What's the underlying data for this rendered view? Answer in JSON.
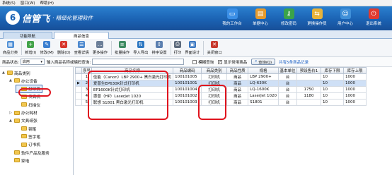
{
  "menu": {
    "items": [
      "系统(S)",
      "窗口(W)",
      "帮助(H)"
    ]
  },
  "brand": {
    "mark": "6",
    "name": "信管飞",
    "tagline": "· 精细化管理软件"
  },
  "topnav": [
    {
      "label": "我的工作台",
      "icon": "desktop-icon",
      "color": "#3b8fe6"
    },
    {
      "label": "单据中心",
      "icon": "document-icon",
      "color": "#e59a2c"
    },
    {
      "label": "修改密码",
      "icon": "user-key-icon",
      "color": "#3aa34a"
    },
    {
      "label": "更换操作员",
      "icon": "switch-user-icon",
      "color": "#e7b33a"
    },
    {
      "label": "用户中心",
      "icon": "user-center-icon",
      "color": "#3f8fd8"
    },
    {
      "label": "退出系统",
      "icon": "power-icon",
      "color": "#e03a2f"
    }
  ],
  "tabs": [
    "功能导航",
    "商品信息"
  ],
  "toolbar": [
    {
      "label": "商品分类",
      "icon": "category-icon",
      "color": "#4f8fd6",
      "glyph": "▦"
    },
    {
      "label": "新增(I)",
      "icon": "add-icon",
      "color": "#43a34a",
      "glyph": "+"
    },
    {
      "label": "修改(M)",
      "icon": "edit-icon",
      "color": "#3b7fd0",
      "glyph": "✎"
    },
    {
      "label": "删除(D)",
      "icon": "delete-icon",
      "color": "#d8352b",
      "glyph": "✕"
    },
    {
      "label": "查看详情",
      "icon": "details-icon",
      "color": "#4d89cf",
      "glyph": "☰"
    },
    {
      "label": "更多操作",
      "icon": "more-icon",
      "color": "#6c7f99",
      "glyph": "…"
    },
    {
      "label": "批量操作",
      "icon": "batch-icon",
      "color": "#3f8c64",
      "glyph": "≡"
    },
    {
      "label": "导入导出",
      "icon": "import-export-icon",
      "color": "#2e78c2",
      "glyph": "⇅"
    },
    {
      "label": "排序设置",
      "icon": "sort-icon",
      "color": "#5b7fb0",
      "glyph": "↕"
    },
    {
      "label": "打印",
      "icon": "print-icon",
      "color": "#5d6b7d",
      "glyph": "⎙"
    },
    {
      "label": "界面设计",
      "icon": "design-icon",
      "color": "#3d79c2",
      "glyph": "▣"
    },
    {
      "label": "关闭窗口",
      "icon": "close-window-icon",
      "color": "#c83a2e",
      "glyph": "✕"
    }
  ],
  "search": {
    "status_label": "商品状态:",
    "status_value": "启用",
    "keyword_label": "输入商品名称或编码查询:",
    "keyword_value": "",
    "fuzzy_label": "模糊查询",
    "fuzzy_checked": false,
    "show_common_label": "显示常用商品",
    "show_common_checked": true,
    "query_button": "查询(Q)",
    "result_text": "共有5条商品记录"
  },
  "tree": [
    {
      "label": "商品类别",
      "level": 0,
      "toggle": "▲"
    },
    {
      "label": "办公设备",
      "level": 1,
      "toggle": "▲"
    },
    {
      "label": "打印机",
      "level": 2,
      "toggle": "",
      "selected": true
    },
    {
      "label": "传真机",
      "level": 2,
      "toggle": ""
    },
    {
      "label": "扫描仪",
      "level": 2,
      "toggle": ""
    },
    {
      "label": "办公耗材",
      "level": 1,
      "toggle": "▷"
    },
    {
      "label": "文具纸张",
      "level": 1,
      "toggle": "▲"
    },
    {
      "label": "钢笔",
      "level": 2,
      "toggle": ""
    },
    {
      "label": "签字笔",
      "level": 2,
      "toggle": ""
    },
    {
      "label": "订书机",
      "level": 2,
      "toggle": ""
    },
    {
      "label": "软件产品及服务",
      "level": 1,
      "toggle": ""
    },
    {
      "label": "家电",
      "level": 1,
      "toggle": ""
    }
  ],
  "grid": {
    "columns": [
      "序号",
      "商品名称",
      "商品编码",
      "商品类别",
      "商品性质",
      "规格",
      "基本单位",
      "预设售价1",
      "库存下限",
      "库存上限"
    ],
    "rows": [
      [
        "1",
        "佳能（Canon）LBP 2900+ 黑白激光打印机",
        "100101005",
        "打印机",
        "商品",
        "LBP 2900+",
        "台",
        "",
        "10",
        "1000"
      ],
      [
        "2",
        "爱普生EP630K针式打印机",
        "100101001",
        "打印机",
        "商品",
        "LQ-630K",
        "台",
        "",
        "10",
        "1000"
      ],
      [
        "3",
        "EP1600K针式打印机",
        "100101004",
        "打印机",
        "商品",
        "LQ-1600K",
        "台",
        "1750",
        "10",
        "1000"
      ],
      [
        "4",
        "惠普（HP）LaserJet 1020",
        "100101002",
        "打印机",
        "商品",
        "LaserJet 1020",
        "台",
        "1180",
        "10",
        "1000"
      ],
      [
        "5",
        "联想 S1801 黑白激光打印机",
        "100101003",
        "打印机",
        "商品",
        "S1801",
        "台",
        "",
        "10",
        "1000"
      ]
    ]
  }
}
